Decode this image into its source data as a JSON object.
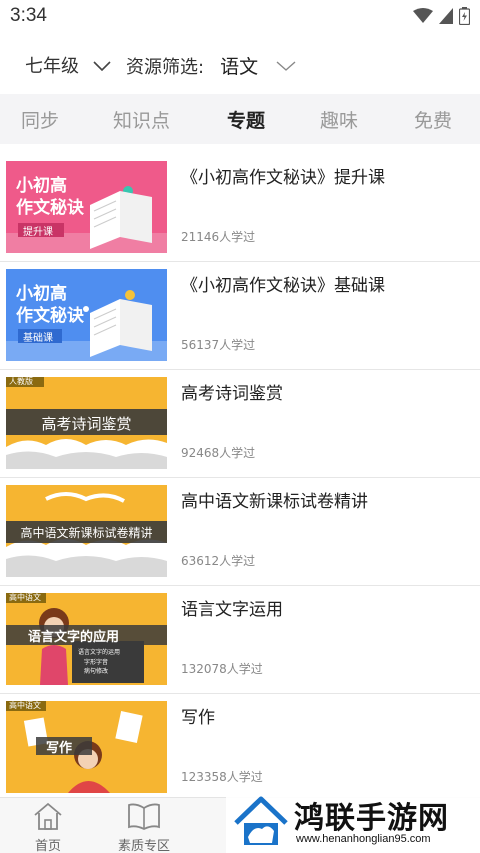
{
  "status": {
    "time": "3:34"
  },
  "filter": {
    "grade": "七年级",
    "resource_label": "资源筛选:",
    "resource_value": "语文"
  },
  "tabs": [
    {
      "label": "同步",
      "active": false
    },
    {
      "label": "知识点",
      "active": false
    },
    {
      "label": "专题",
      "active": true
    },
    {
      "label": "趣味",
      "active": false
    },
    {
      "label": "免费",
      "active": false
    }
  ],
  "courses": [
    {
      "title": "《小初高作文秘诀》提升课",
      "learners": "21146人学过",
      "thumb": {
        "line1": "小初高",
        "line2": "作文秘诀",
        "tag": "提升课",
        "bg": "#ef5a8a"
      }
    },
    {
      "title": "《小初高作文秘诀》基础课",
      "learners": "56137人学过",
      "thumb": {
        "line1": "小初高",
        "line2": "作文秘诀",
        "tag": "基础课",
        "bg": "#4f8ef0"
      }
    },
    {
      "title": "高考诗词鉴赏",
      "learners": "92468人学过",
      "thumb": {
        "corner": "人教版",
        "banner": "高考诗词鉴赏",
        "bg": "#f6b531"
      }
    },
    {
      "title": "高中语文新课标试卷精讲",
      "learners": "63612人学过",
      "thumb": {
        "banner": "高中语文新课标试卷精讲",
        "bg": "#f6b531"
      }
    },
    {
      "title": "语言文字运用",
      "learners": "132078人学过",
      "thumb": {
        "corner": "高中语文",
        "banner": "语言文字的应用",
        "board1": "语言文字的运用",
        "board2": "字形字音",
        "board3": "病句修改",
        "bg": "#f6b531"
      }
    },
    {
      "title": "写作",
      "learners": "123358人学过",
      "thumb": {
        "corner": "高中语文",
        "banner": "写作",
        "bg": "#f6b531"
      }
    }
  ],
  "bottom_nav": [
    {
      "label": "首页"
    },
    {
      "label": "素质专区"
    }
  ],
  "watermark": {
    "text": "鸿联手游网",
    "url": "www.henanhonglian95.com"
  }
}
